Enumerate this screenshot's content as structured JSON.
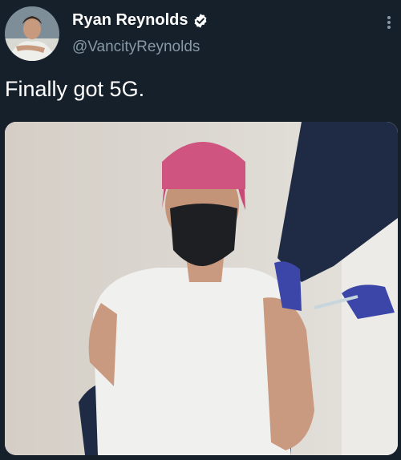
{
  "tweet": {
    "display_name": "Ryan Reynolds",
    "handle": "@VancityReynolds",
    "text": "Finally got 5G."
  },
  "icons": {
    "verified": "verified-badge-icon",
    "more": "more-vertical-icon"
  },
  "colors": {
    "background": "#15202b",
    "secondary_text": "#8899a6",
    "primary_text": "#ffffff"
  }
}
